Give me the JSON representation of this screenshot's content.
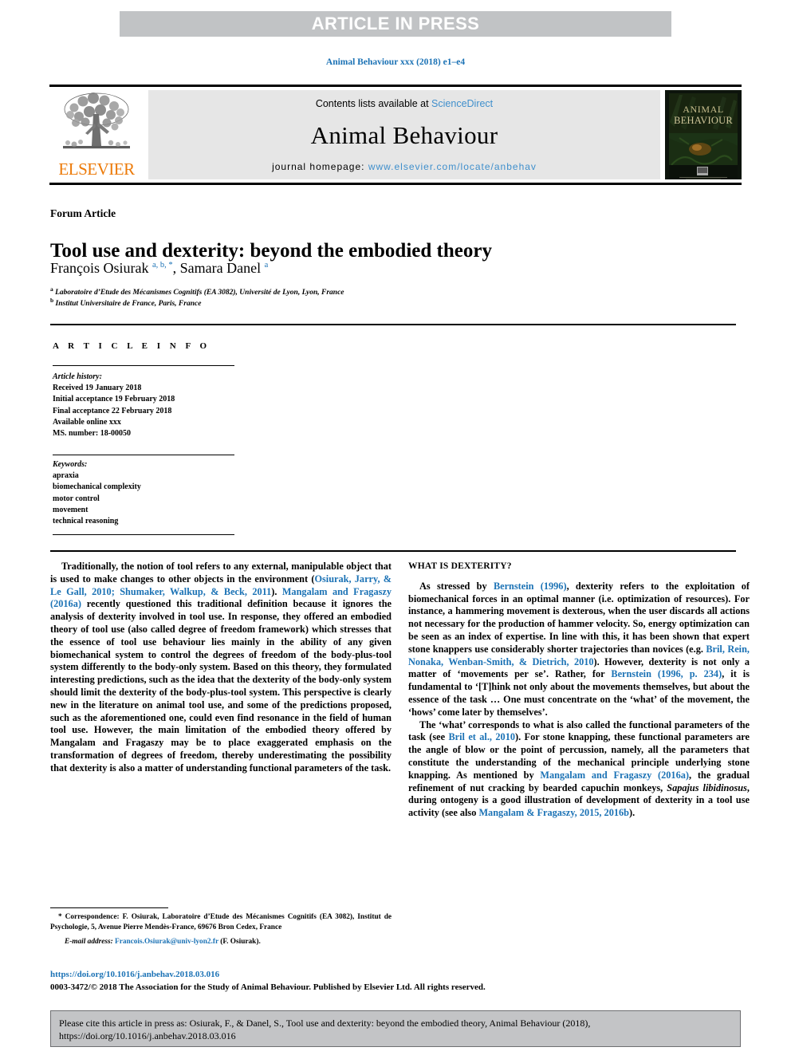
{
  "banner": {
    "text": "ARTICLE IN PRESS"
  },
  "running_head": {
    "text": "Animal Behaviour xxx (2018) e1–e4",
    "color": "#1b72b5"
  },
  "masthead": {
    "publisher_logo_text": "ELSEVIER",
    "publisher_logo_color": "#ec7a08",
    "contents_prefix": "Contents lists available at",
    "contents_link": "ScienceDirect",
    "journal_title": "Animal Behaviour",
    "homepage_prefix": "journal homepage:",
    "homepage_url": "www.elsevier.com/locate/anbehav",
    "link_color": "#3f8fcc",
    "cover_title_line1": "ANIMAL",
    "cover_title_line2": "BEHAVIOUR"
  },
  "article": {
    "type_label": "Forum Article",
    "title": "Tool use and dexterity: beyond the embodied theory",
    "authors_html": "François Osiurak <sup>a, b, *</sup>, Samara Danel <sup>a</sup>",
    "affiliation_a": "Laboratoire d’Etude des Mécanismes Cognitifs (EA 3082), Université de Lyon, Lyon, France",
    "affiliation_b": "Institut Universitaire de France, Paris, France",
    "affiliation_a_marker": "a",
    "affiliation_b_marker": "b"
  },
  "info": {
    "heading": "A R T I C L E   I N F O",
    "history_label": "Article history:",
    "history": [
      "Received 19 January 2018",
      "Initial acceptance 19 February 2018",
      "Final acceptance 22 February 2018",
      "Available online xxx",
      "MS. number: 18-00050"
    ],
    "keywords_label": "Keywords:",
    "keywords": [
      "apraxia",
      "biomechanical complexity",
      "motor control",
      "movement",
      "technical reasoning"
    ]
  },
  "body": {
    "left_paragraph_html": "Traditionally, the notion of tool refers to any external, manipulable object that is used to make changes to other objects in the environment (<a class=\"ref\" href=\"#\">Osiurak, Jarry, &amp; Le Gall, 2010; Shumaker, Walkup, &amp; Beck, 2011</a>). <a class=\"ref\" href=\"#\">Mangalam and Fragaszy (2016a)</a> recently questioned this traditional definition because it ignores the analysis of dexterity involved in tool use. In response, they offered an embodied theory of tool use (also called degree of freedom framework) which stresses that the essence of tool use behaviour lies mainly in the ability of any given biomechanical system to control the degrees of freedom of the body-plus-tool system differently to the body-only system. Based on this theory, they formulated interesting predictions, such as the idea that the dexterity of the body-only system should limit the dexterity of the body-plus-tool system. This perspective is clearly new in the literature on animal tool use, and some of the predictions proposed, such as the aforementioned one, could even find resonance in the field of human tool use. However, the main limitation of the embodied theory offered by Mangalam and Fragaszy may be to place exaggerated emphasis on the transformation of degrees of freedom, thereby underestimating the possibility that dexterity is also a matter of understanding functional parameters of the task.",
    "right_section_heading": "WHAT IS DEXTERITY?",
    "right_paragraph_1_html": "As stressed by <a class=\"ref\" href=\"#\">Bernstein (1996)</a>, dexterity refers to the exploitation of biomechanical forces in an optimal manner (i.e. optimization of resources). For instance, a hammering movement is dexterous, when the user discards all actions not necessary for the production of hammer velocity. So, energy optimization can be seen as an index of expertise. In line with this, it has been shown that expert stone knappers use considerably shorter trajectories than novices (e.g. <a class=\"ref\" href=\"#\">Bril, Rein, Nonaka, Wenban-Smith, &amp; Dietrich, 2010</a>). However, dexterity is not only a matter of ‘movements per se’. Rather, for <a class=\"ref\" href=\"#\">Bernstein (1996, p. 234)</a>, it is fundamental to ‘[T]hink not only about the movements themselves, but about the essence of the task … One must concentrate on the ‘what’ of the movement, the ‘hows’ come later by themselves’.",
    "right_paragraph_2_html": "The ‘what’ corresponds to what is also called the functional parameters of the task (see <a class=\"ref\" href=\"#\">Bril et al., 2010</a>). For stone knapping, these functional parameters are the angle of blow or the point of percussion, namely, all the parameters that constitute the understanding of the mechanical principle underlying stone knapping. As mentioned by <a class=\"ref\" href=\"#\">Mangalam and Fragaszy (2016a)</a>, the gradual refinement of nut cracking by bearded capuchin monkeys, <span class=\"it\">Sapajus libidinosus</span>, during ontogeny is a good illustration of development of dexterity in a tool use activity (see also <a class=\"ref\" href=\"#\">Mangalam &amp; Fragaszy, 2015, 2016b</a>)."
  },
  "footnote": {
    "correspondence_html": "* Correspondence: F. Osiurak, Laboratoire d’Etude des Mécanismes Cognitifs (EA 3082), Institut de Psychologie, 5, Avenue Pierre Mendès-France, 69676 Bron Cedex, France",
    "email_label": "E-mail address:",
    "email_value": "Francois.Osiurak@univ-lyon2.fr",
    "email_suffix": "(F. Osiurak)."
  },
  "footer": {
    "doi": "https://doi.org/10.1016/j.anbehav.2018.03.016",
    "copyright": "0003-3472/© 2018 The Association for the Study of Animal Behaviour. Published by Elsevier Ltd. All rights reserved."
  },
  "cite_box": {
    "text": "Please cite this article in press as: Osiurak, F., & Danel, S., Tool use and dexterity: beyond the embodied theory, Animal Behaviour (2018), https://doi.org/10.1016/j.anbehav.2018.03.016"
  }
}
